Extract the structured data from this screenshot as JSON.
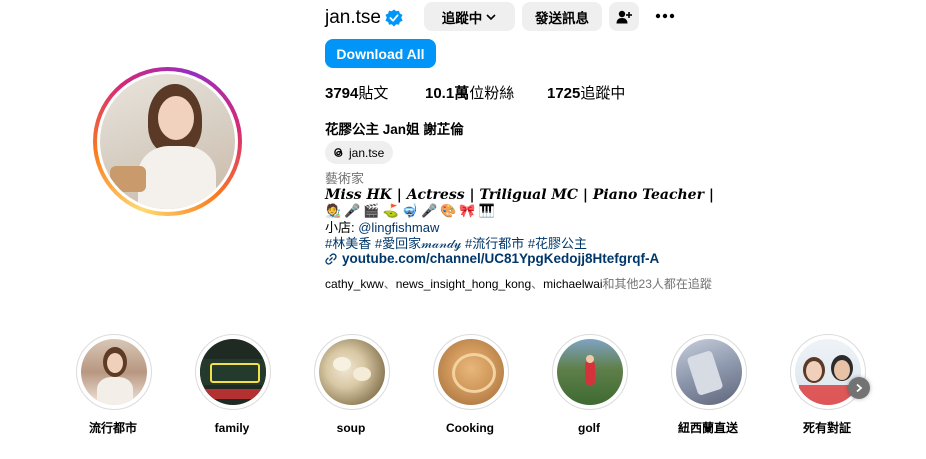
{
  "profile": {
    "username": "jan.tse",
    "verified": true,
    "following_button": "追蹤中",
    "message_button": "發送訊息",
    "download_button": "Download All",
    "posts": "3794",
    "posts_label": "貼文",
    "followers": "10.1萬",
    "followers_label": "位粉絲",
    "following": "1725",
    "following_label": "追蹤中",
    "full_name": "花膠公主 Jan姐 謝芷倫",
    "threads_handle": "jan.tse",
    "category": "藝術家",
    "bio_line1": "Miss HK | Actress | Triligual MC | Piano Teacher |",
    "bio_emojis": [
      "🧑‍🎨",
      "🎤",
      "🎬",
      "⛳",
      "🤿",
      "🎤",
      "🎨",
      "🎀",
      "🎹"
    ],
    "shop_prefix": "小店: ",
    "shop_handle": "@lingfishmaw",
    "hashtags": "#林美香 #愛回家𝓂𝒶𝓃𝒹𝓎 #流行都市 #花膠公主",
    "external_link": "youtube.com/channel/UC81YpgKedojj8Htefgrqf-A",
    "followed_by_users": [
      "cathy_kww",
      "news_insight_hong_kong",
      "michaelwai"
    ],
    "followed_by_suffix": "和其他23人都在追蹤"
  },
  "highlights": [
    {
      "label": "流行都市"
    },
    {
      "label": "family"
    },
    {
      "label": "soup"
    },
    {
      "label": "Cooking"
    },
    {
      "label": "golf"
    },
    {
      "label": "紐西蘭直送"
    },
    {
      "label": "死有對証"
    }
  ],
  "colors": {
    "accent": "#0095f6",
    "link": "#00376b",
    "secondary_text": "#737373",
    "button_bg": "#efefef"
  }
}
